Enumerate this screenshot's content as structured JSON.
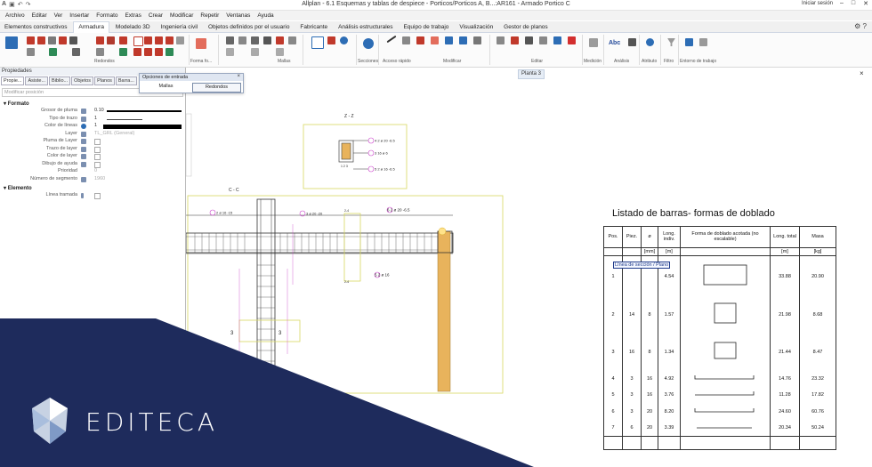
{
  "window": {
    "title": "Allplan - 6.1 Esquemas y tablas de despiece - Porticos/Porticos A, B...:AR161 - Armado Portico C",
    "signin": "Iniciar sesión"
  },
  "menu": [
    "Archivo",
    "Editar",
    "Ver",
    "Insertar",
    "Formato",
    "Extras",
    "Crear",
    "Modificar",
    "Repetir",
    "Ventanas",
    "Ayuda"
  ],
  "ribbon_tabs": [
    {
      "label": "Elementos constructivos"
    },
    {
      "label": "Armadura",
      "active": true
    },
    {
      "label": "Modelado 3D"
    },
    {
      "label": "Ingeniería civil"
    },
    {
      "label": "Objetos definidos por el usuario"
    },
    {
      "label": "Fabricante"
    },
    {
      "label": "Análisis estructurales"
    },
    {
      "label": "Equipo de trabajo"
    },
    {
      "label": "Visualización"
    },
    {
      "label": "Gestor de planos"
    }
  ],
  "ribbon_groups": [
    "Redondos",
    "Forma fo...",
    "Mallas",
    "Secciones",
    "Acceso rápido",
    "Modificar",
    "Editar",
    "Medición",
    "Análisis",
    "Atributo",
    "Filtro",
    "Entorno de trabajo"
  ],
  "ribbon_text_icon": "Abc",
  "properties": {
    "header": "Propiedades",
    "tabs": [
      "Propie...",
      "Asiste...",
      "Biblio...",
      "Objetos",
      "Planos",
      "Barra..."
    ],
    "filter_placeholder": "Modificar posición",
    "format_section": "Formato",
    "rows": [
      {
        "label": "Grosor de pluma",
        "value": "0.10"
      },
      {
        "label": "Tipo de trazo",
        "value": "1"
      },
      {
        "label": "Color de líneas",
        "value": "1"
      },
      {
        "label": "Layer",
        "value": "TL_GRL (General)"
      },
      {
        "label": "Pluma de Layer",
        "value": ""
      },
      {
        "label": "Trazo de layer",
        "value": ""
      },
      {
        "label": "Color de layer",
        "value": ""
      },
      {
        "label": "Dibujo de ayuda",
        "value": ""
      },
      {
        "label": "Prioridad",
        "value": "0"
      },
      {
        "label": "Número de segmento",
        "value": "1960"
      }
    ],
    "element_section": "Elemento",
    "element_rows": [
      {
        "label": "Línea tramada",
        "value": ""
      }
    ]
  },
  "input_options": {
    "title": "Opciones de entrada",
    "options": [
      "Mallas",
      "Redondos"
    ],
    "selected": "Redondos"
  },
  "view_tab": "Planta 3",
  "drawing": {
    "section_zz": "Z - Z",
    "section_cc": "C - C",
    "labels_zz": [
      "4 2 ø 20 -6.5",
      "3 16 ø 6",
      "1 2 3",
      "5 2 ø 16 -6.5"
    ],
    "labels_cc": [
      "2 ø 16 -15",
      "3 ø 20 -20",
      "6 2 ø 20 -6.5",
      "5 2 ø 16",
      "7 3 ø 20",
      "3",
      "3",
      "2-4",
      "2-4"
    ]
  },
  "bar_list": {
    "title": "Listado de barras- formas de doblado",
    "headers": [
      "Pos.",
      "Piez.",
      "ø",
      "Long. indiv.",
      "Forma de doblado acotada (no escalable)",
      "Long. total",
      "Masa"
    ],
    "units": [
      "",
      "",
      "[mm]",
      "[m]",
      "",
      "[m]",
      "[kg]"
    ],
    "tag": "Línea de sección / Plano",
    "rows": [
      {
        "pos": "1",
        "piez": "",
        "diam": "",
        "long": "4.54",
        "total": "33.88",
        "masa": "20.90"
      },
      {
        "pos": "2",
        "piez": "14",
        "diam": "8",
        "long": "1.57",
        "total": "21.98",
        "masa": "8.68"
      },
      {
        "pos": "3",
        "piez": "16",
        "diam": "8",
        "long": "1.34",
        "total": "21.44",
        "masa": "8.47"
      },
      {
        "pos": "4",
        "piez": "3",
        "diam": "16",
        "long": "4.92",
        "total": "14.76",
        "masa": "23.32"
      },
      {
        "pos": "5",
        "piez": "3",
        "diam": "16",
        "long": "3.76",
        "total": "11.28",
        "masa": "17.82"
      },
      {
        "pos": "6",
        "piez": "3",
        "diam": "20",
        "long": "8.20",
        "total": "24.60",
        "masa": "60.76"
      },
      {
        "pos": "7",
        "piez": "6",
        "diam": "20",
        "long": "3.39",
        "total": "20.34",
        "masa": "50.24"
      }
    ]
  },
  "brand": "EDITECA",
  "colors": {
    "accent": "#e8b35c",
    "banner": "#1e2b5c",
    "highlight": "#cc44cc"
  }
}
